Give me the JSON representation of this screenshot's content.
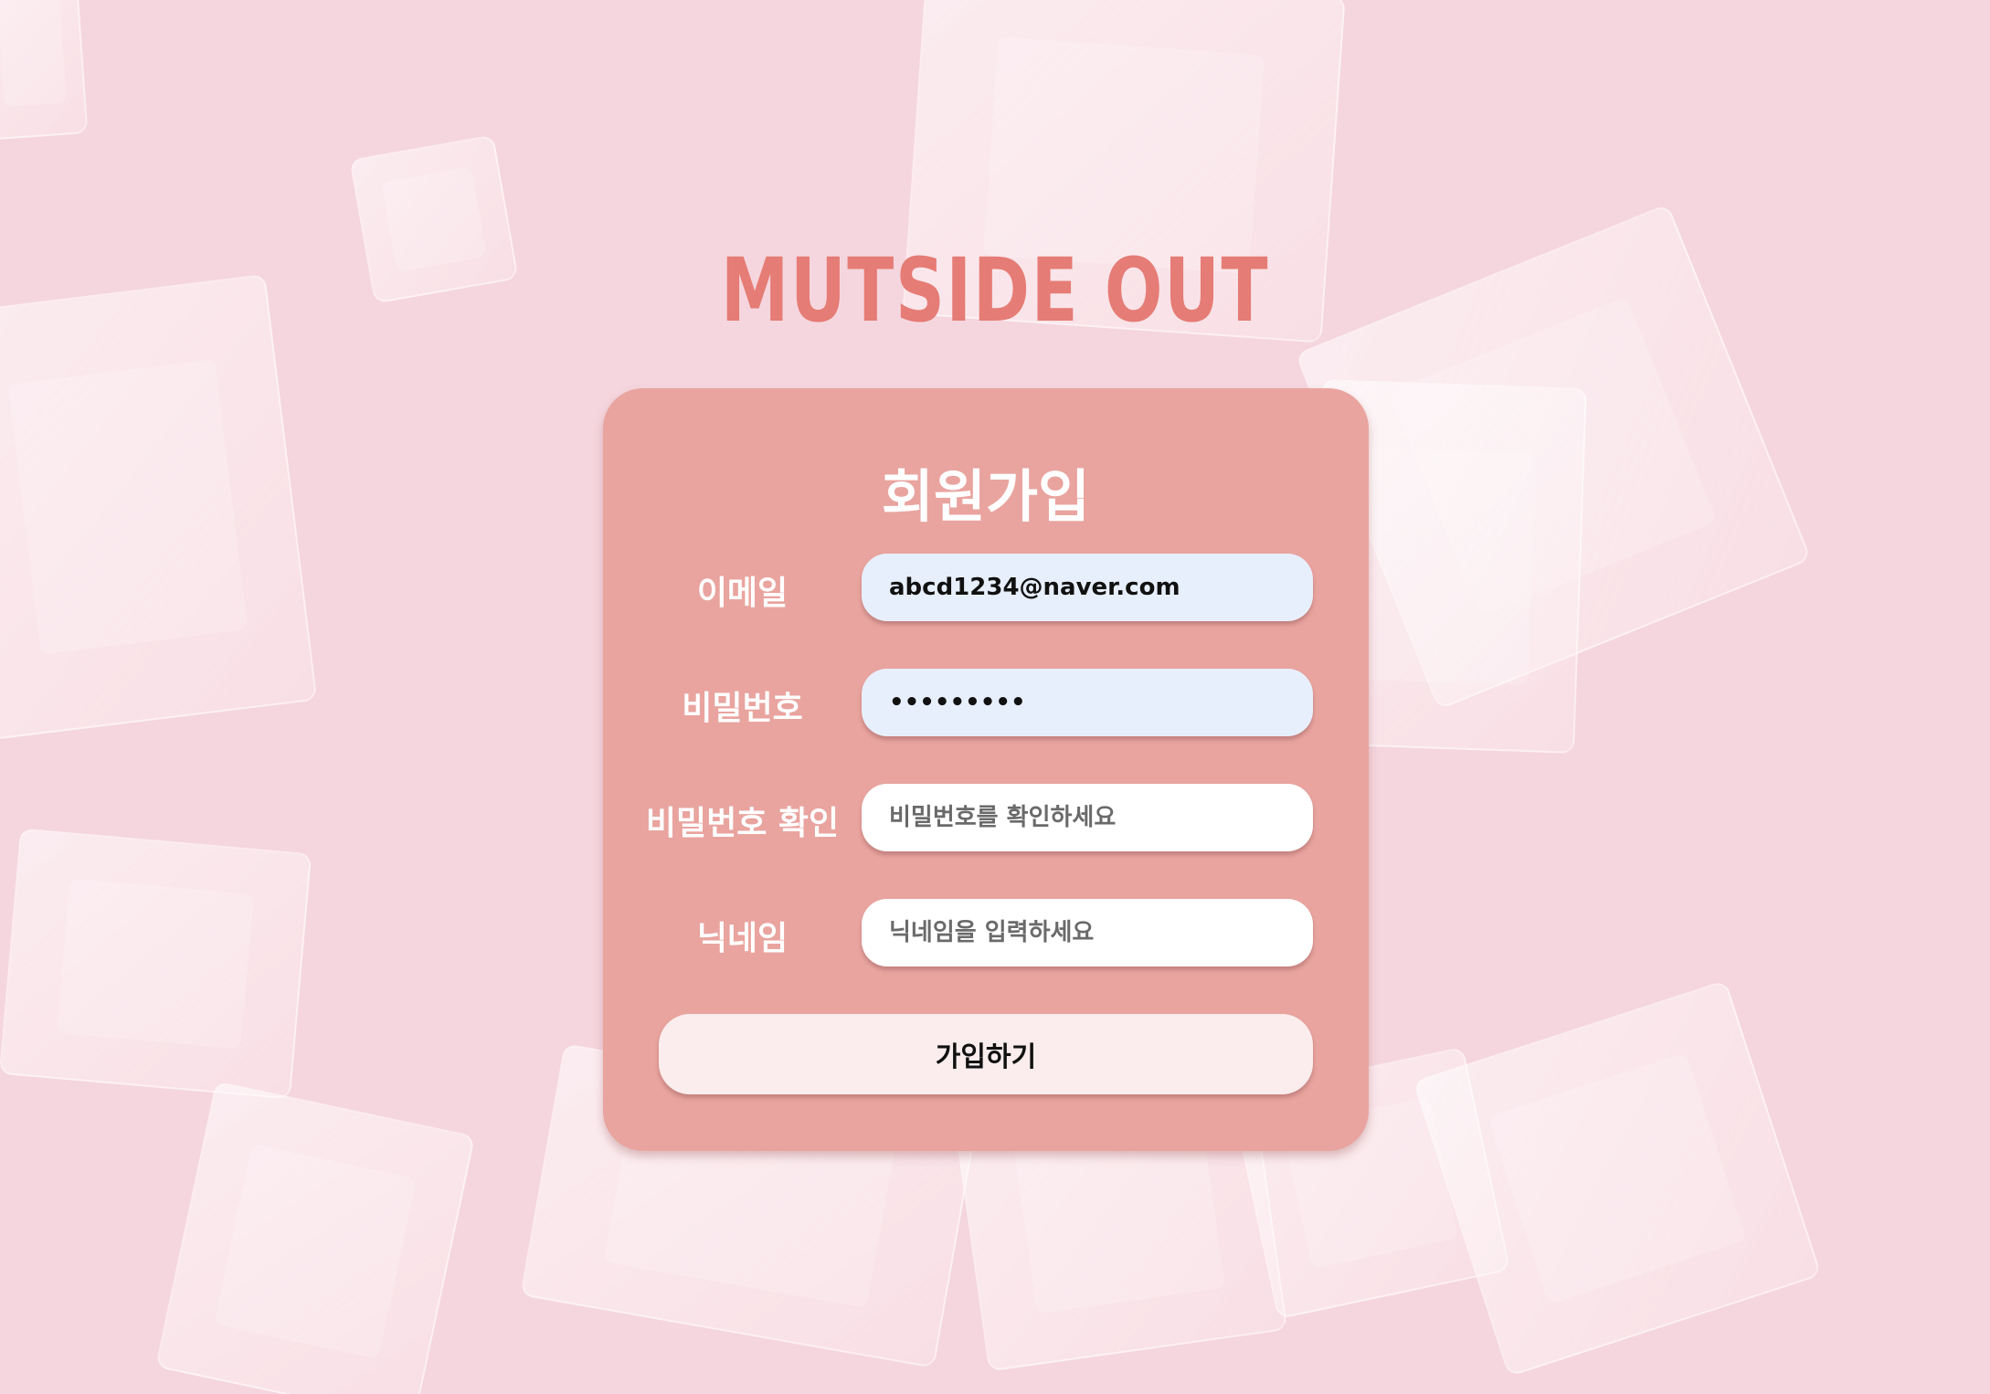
{
  "app": {
    "logo_text": "MUTSIDE OUT"
  },
  "signup": {
    "title": "회원가입",
    "fields": [
      {
        "label": "이메일",
        "value": "abcd1234@naver.com",
        "placeholder": ""
      },
      {
        "label": "비밀번호",
        "value": "•••••••••",
        "placeholder": ""
      },
      {
        "label": "비밀번호 확인",
        "value": "",
        "placeholder": "비밀번호를 확인하세요"
      },
      {
        "label": "닉네임",
        "value": "",
        "placeholder": "닉네임을 입력하세요"
      }
    ],
    "submit_label": "가입하기"
  },
  "colors": {
    "background": "#f5d6de",
    "card": "#e9a49f",
    "logo": "#e57c75",
    "filled_input": "#e8effc",
    "button": "#fbeded"
  }
}
